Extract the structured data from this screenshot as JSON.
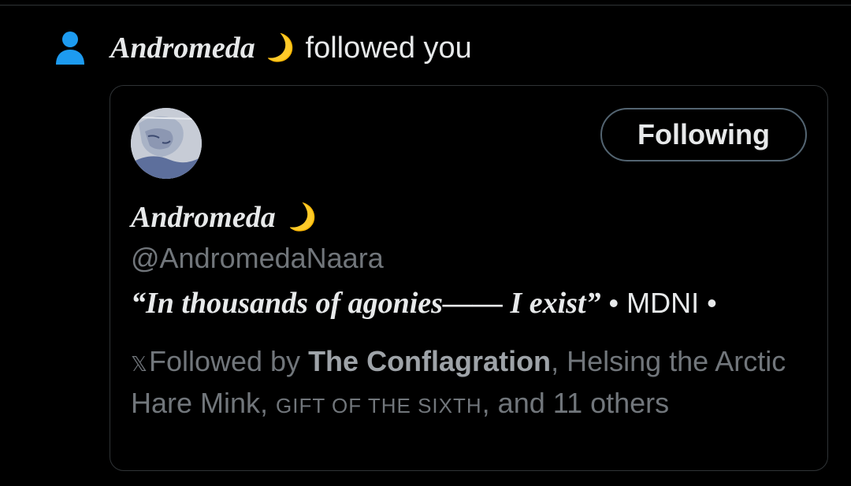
{
  "notification": {
    "icon": "person-icon",
    "icon_color": "#1d9bf0",
    "user_name": "Andromeda",
    "moon": "🌙",
    "action_text": "followed you"
  },
  "card": {
    "follow_button_label": "Following",
    "display_name": "Andromeda",
    "moon": "🌙",
    "handle": "@AndromedaNaara",
    "bio_quote": "“In thousands of agonies—— I exist”",
    "bio_tail": "• MDNI •",
    "followed_by": {
      "x_mark": "𝕏",
      "prefix": "Followed by",
      "name1": "The Conflagration",
      "sep1": ", Helsing the Arctic Hare Mink, ",
      "name3": "GIFT OF THE SIXTH",
      "suffix": ", and 11 others"
    }
  }
}
